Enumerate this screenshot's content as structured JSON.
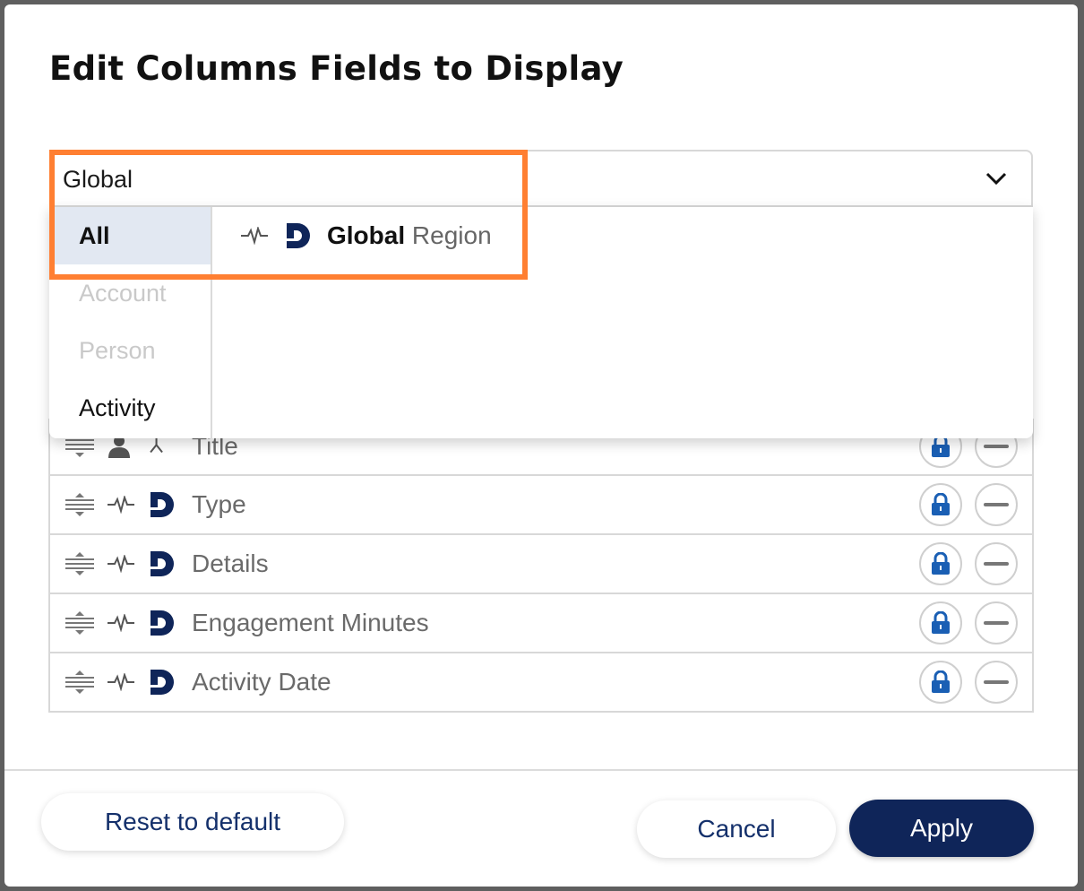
{
  "dialog": {
    "title": "Edit Columns Fields to Display"
  },
  "selector": {
    "value": "Global",
    "chevron_icon": "chevron-down-icon"
  },
  "dropdown": {
    "categories": [
      {
        "label": "All",
        "state": "active"
      },
      {
        "label": "Account",
        "state": "disabled"
      },
      {
        "label": "Person",
        "state": "disabled"
      },
      {
        "label": "Activity",
        "state": "normal"
      }
    ],
    "options": [
      {
        "bold": "Global",
        "rest": " Region",
        "source_icon": "activity-pulse-icon",
        "brand_icon": "d-logo-icon"
      }
    ]
  },
  "fields": [
    {
      "label": "Title",
      "source_icon": "person-icon"
    },
    {
      "label": "Type",
      "source_icon": "activity-pulse-icon"
    },
    {
      "label": "Details",
      "source_icon": "activity-pulse-icon"
    },
    {
      "label": "Engagement Minutes",
      "source_icon": "activity-pulse-icon"
    },
    {
      "label": "Activity Date",
      "source_icon": "activity-pulse-icon"
    }
  ],
  "footer": {
    "reset_label": "Reset to default",
    "cancel_label": "Cancel",
    "apply_label": "Apply"
  },
  "colors": {
    "brand_navy": "#0f2559",
    "lock_blue": "#1a5fb4",
    "highlight_orange": "#ff7f32"
  }
}
